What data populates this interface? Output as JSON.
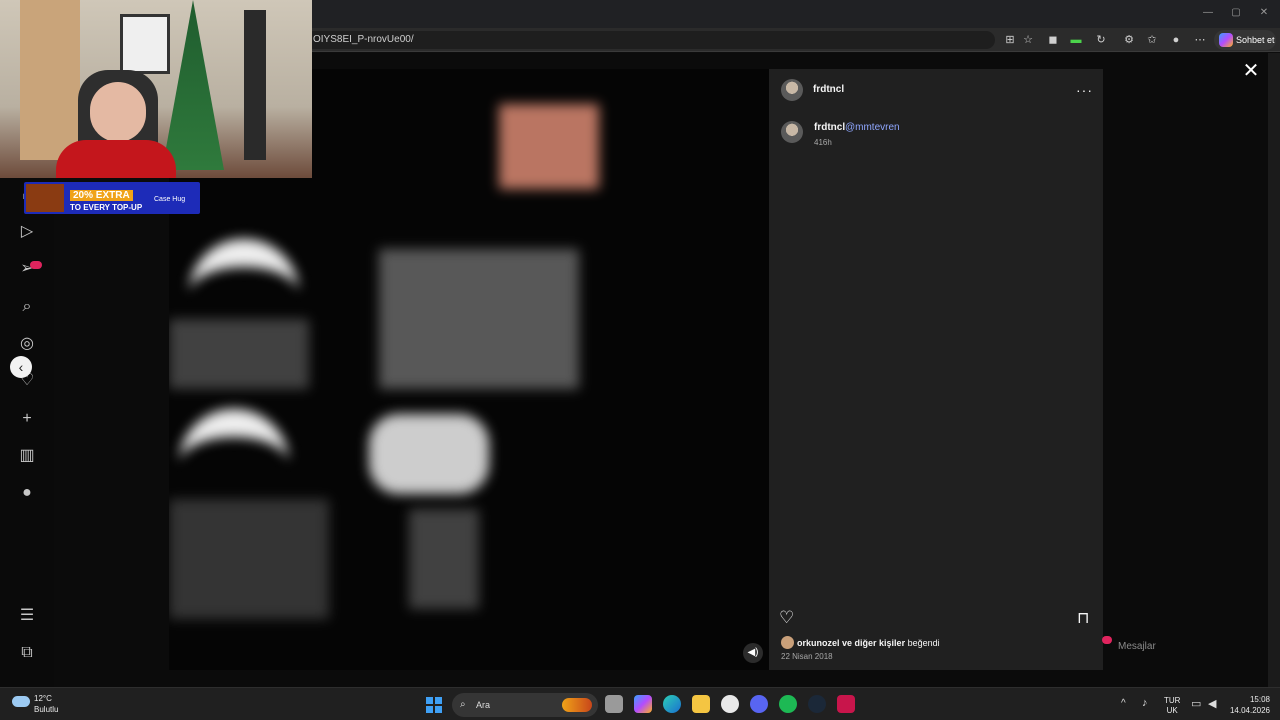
{
  "browser": {
    "url": "OIYS8EI_P-nrovUe00/",
    "chat_label": "Sohbet et",
    "win_min": "—",
    "win_max": "▢",
    "win_close": "✕",
    "toolbar_icons": [
      "app-icon",
      "star-icon",
      "extension-icon",
      "extension-green-icon",
      "refresh-icon",
      "extensions-icon",
      "favorites-icon",
      "profile-icon",
      "more-icon"
    ]
  },
  "sidebar": {
    "icons": [
      "home-icon",
      "reels-icon",
      "messages-icon",
      "search-icon",
      "explore-icon",
      "notifications-icon",
      "create-icon",
      "dashboard-icon",
      "profile-icon",
      "menu-icon",
      "more-apps-icon"
    ]
  },
  "post": {
    "header_username": "frdtncl",
    "more_label": "···",
    "caption_username": "frdtncl",
    "caption_mention": "@mmtevren",
    "caption_time": "416h",
    "liked_by_user": "orkunozel",
    "liked_by_rest": "ve diğer kişiler",
    "liked_suffix": "beğendi",
    "date": "22 Nisan 2018"
  },
  "close_label": "✕",
  "messages_label": "Mesajlar",
  "ad": {
    "line1": "20% EXTRA",
    "line2": "TO EVERY TOP-UP",
    "brand": "Case Hug"
  },
  "taskbar": {
    "weather_temp": "12°C",
    "weather_desc": "Bulutlu",
    "search_label": "Ara",
    "lang_line1": "TUR",
    "lang_line2": "UK",
    "time": "15:08",
    "date": "14.04.2026"
  },
  "colors": {
    "panel_bg": "#202020",
    "mention": "#8fa7ff",
    "badge": "#e0245e",
    "taskbar": "#202020"
  }
}
